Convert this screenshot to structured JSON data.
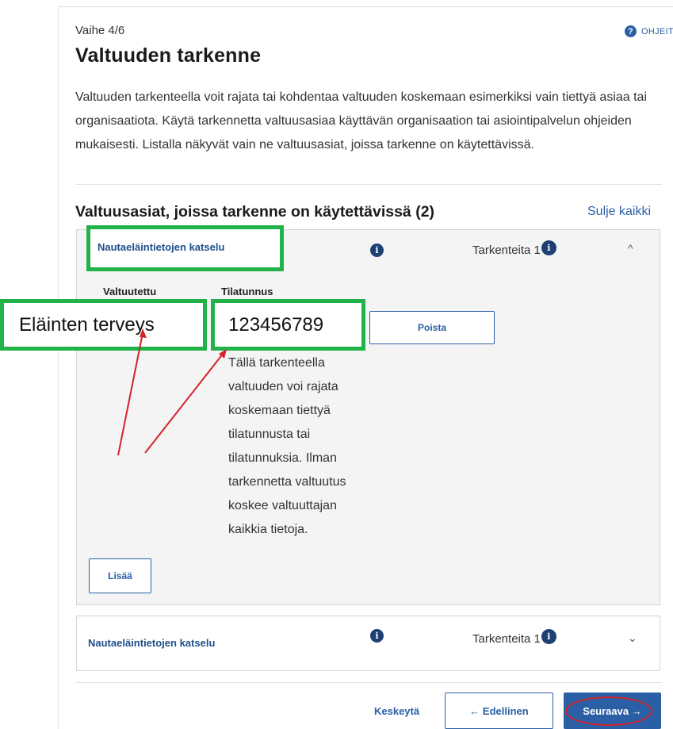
{
  "header": {
    "step": "Vaihe 4/6",
    "help_label": "OHJEITA",
    "title": "Valtuuden tarkenne"
  },
  "intro_text": "Valtuuden tarkenteella voit rajata tai kohdentaa valtuuden koskemaan esimerkiksi vain tiettyä asiaa tai organisaatiota. Käytä tarkennetta valtuusasiaa käyttävän organisaation tai asiointipalvelun ohjeiden mukaisesti. Listalla näkyvät vain ne valtuusasiat, joissa tarkenne on käytettävissä.",
  "section": {
    "title": "Valtuusasiat, joissa tarkenne on käytettävissä (2)",
    "close_all_label": "Sulje kaikki"
  },
  "cases": [
    {
      "title": "Nautaeläintietojen katselu",
      "refinements_label": "Tarkenteita 1",
      "expanded": true,
      "columns": {
        "authorized": "Valtuutettu",
        "farm_id": "Tilatunnus"
      },
      "entry": {
        "authorized_value": "Eläinten terveys",
        "farm_id_value": "123456789"
      },
      "remove_label": "Poista",
      "add_label": "Lisää",
      "description": "Tällä tarkenteella valtuuden voi rajata koskemaan tiettyä tilatunnusta tai tilatunnuksia. Ilman tarkennetta valtuutus koskee valtuuttajan kaikkia tietoja."
    },
    {
      "title": "Nautaeläintietojen katselu",
      "refinements_label": "Tarkenteita 1",
      "expanded": false
    }
  ],
  "footer": {
    "cancel_label": "Keskeytä",
    "prev_label": "← Edellinen",
    "next_label": "Seuraava →"
  },
  "icons": {
    "help": "question-circle-icon",
    "info": "info-circle-icon",
    "chevron_up": "chevron-up-icon",
    "chevron_down": "chevron-down-icon"
  },
  "colors": {
    "accent": "#2a5fa5",
    "annotation_green": "#21b34a",
    "annotation_red": "#d4232b"
  }
}
